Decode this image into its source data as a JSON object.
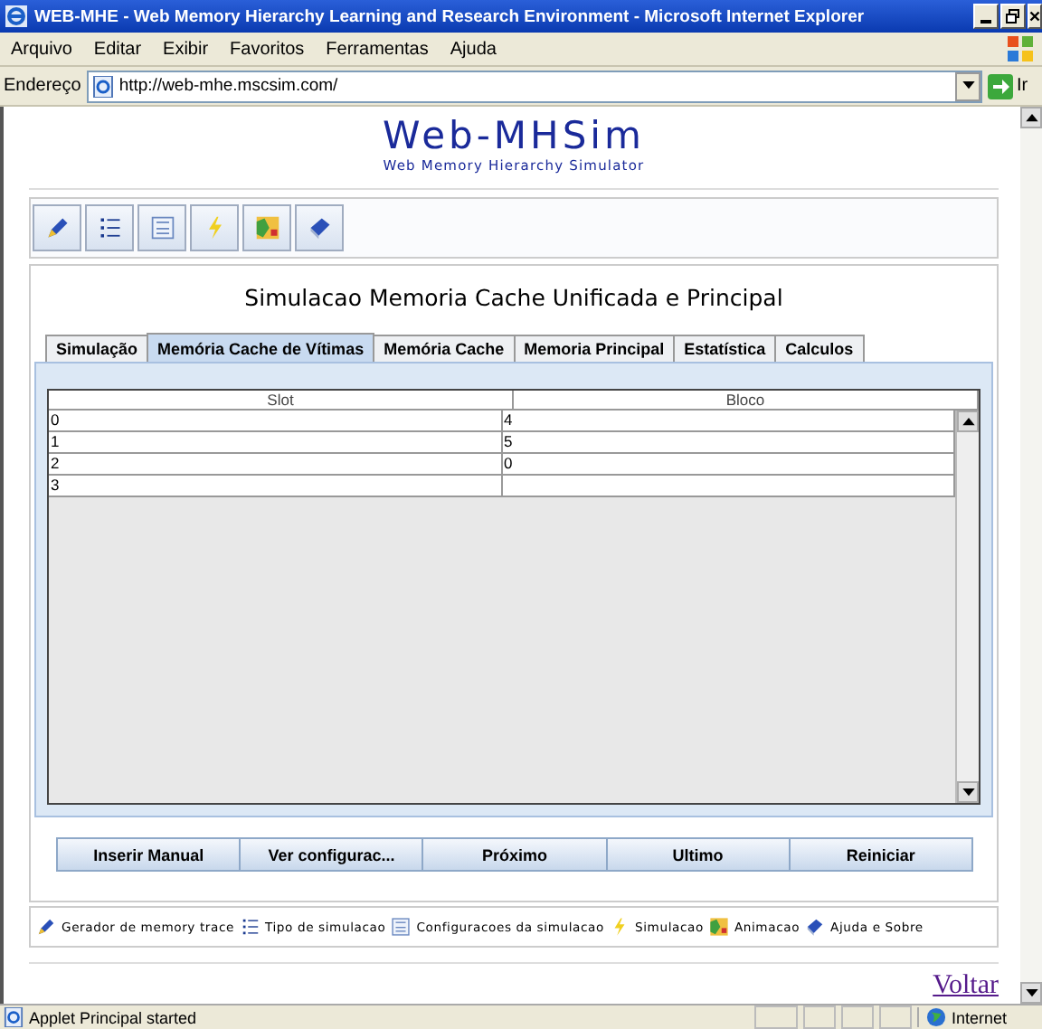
{
  "window": {
    "title": "WEB-MHE - Web Memory Hierarchy Learning and Research Environment - Microsoft Internet Explorer"
  },
  "menu": [
    "Arquivo",
    "Editar",
    "Exibir",
    "Favoritos",
    "Ferramentas",
    "Ajuda"
  ],
  "address": {
    "label": "Endereço",
    "value": "http://web-mhe.mscsim.com/",
    "go": "Ir"
  },
  "logo": {
    "title": "Web-MHSim",
    "subtitle": "Web Memory Hierarchy Simulator"
  },
  "toolbar": [
    {
      "kind": "pen"
    },
    {
      "kind": "list"
    },
    {
      "kind": "form"
    },
    {
      "kind": "bolt"
    },
    {
      "kind": "map"
    },
    {
      "kind": "book"
    }
  ],
  "heading": "Simulacao Memoria Cache Unificada e Principal",
  "tabs": [
    {
      "label": "Simulação",
      "selected": false
    },
    {
      "label": "Memória Cache de Vítimas",
      "selected": true
    },
    {
      "label": "Memória Cache",
      "selected": false
    },
    {
      "label": "Memoria Principal",
      "selected": false
    },
    {
      "label": "Estatística",
      "selected": false
    },
    {
      "label": "Calculos",
      "selected": false
    }
  ],
  "table": {
    "columns": [
      "Slot",
      "Bloco"
    ],
    "rows": [
      [
        "0",
        "4"
      ],
      [
        "1",
        "5"
      ],
      [
        "2",
        "0"
      ],
      [
        "3",
        ""
      ]
    ]
  },
  "buttons": [
    "Inserir Manual",
    "Ver configurac...",
    "Próximo",
    "Ultimo",
    "Reiniciar"
  ],
  "legend": [
    {
      "kind": "pen",
      "label": "Gerador de memory trace"
    },
    {
      "kind": "list",
      "label": "Tipo de simulacao"
    },
    {
      "kind": "form",
      "label": "Configuracoes da simulacao"
    },
    {
      "kind": "bolt",
      "label": "Simulacao"
    },
    {
      "kind": "map",
      "label": "Animacao"
    },
    {
      "kind": "book",
      "label": "Ajuda e Sobre"
    }
  ],
  "link": "Voltar",
  "status_bar": {
    "text": "Applet Principal started",
    "zone": "Internet"
  }
}
